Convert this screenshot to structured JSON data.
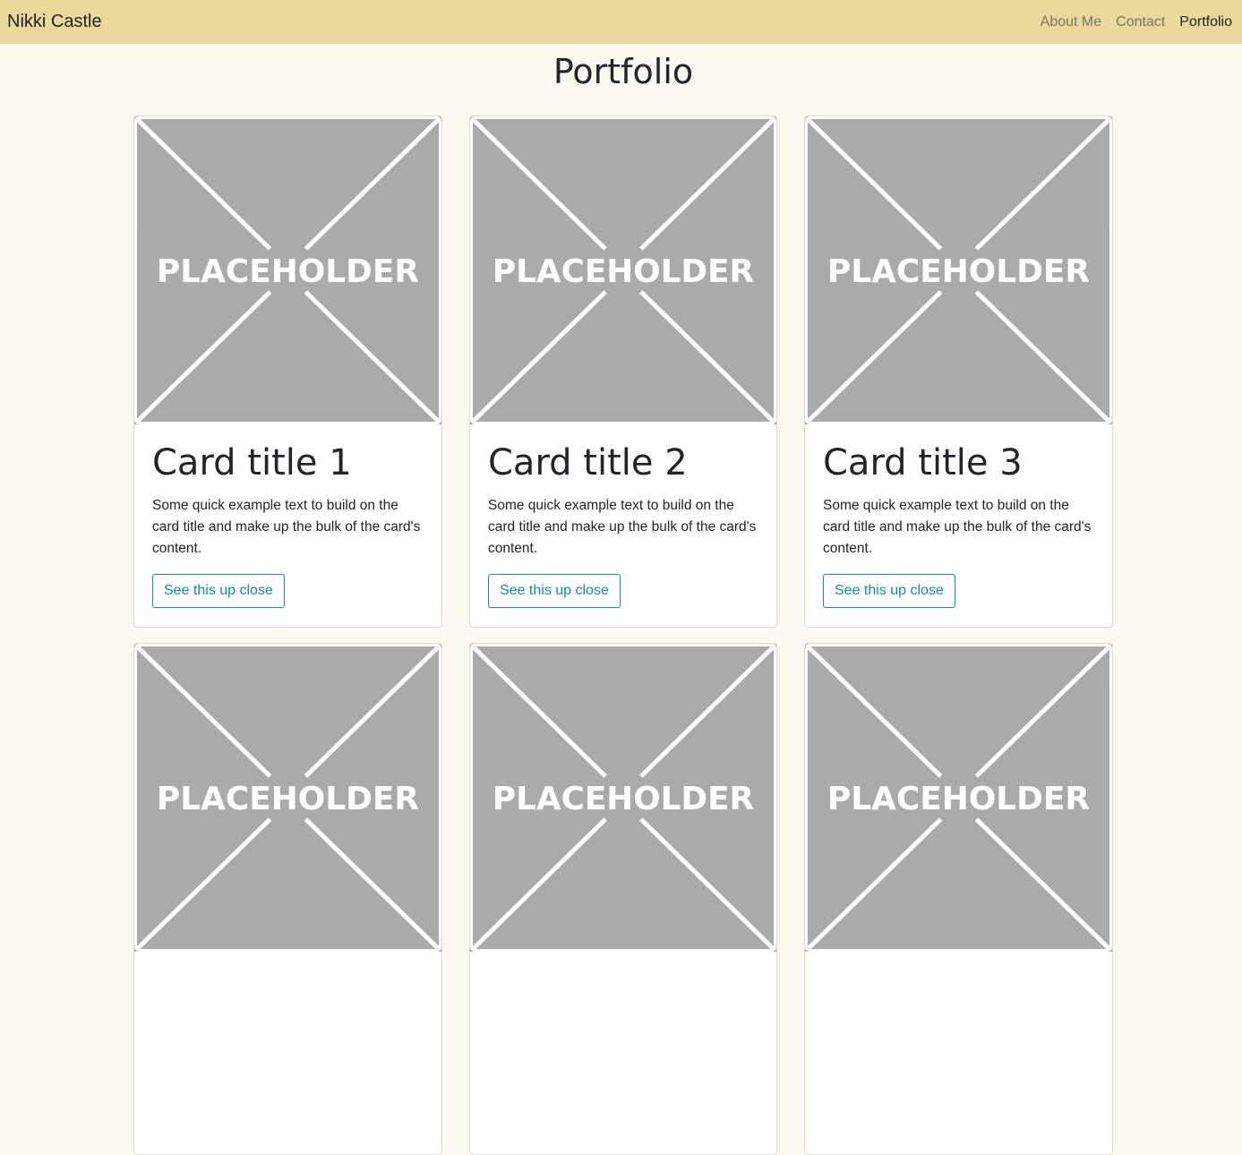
{
  "nav": {
    "brand": "Nikki Castle",
    "links": [
      {
        "label": "About Me",
        "active": false
      },
      {
        "label": "Contact",
        "active": false
      },
      {
        "label": "Portfolio",
        "active": true
      }
    ]
  },
  "page": {
    "title": "Portfolio"
  },
  "placeholder_text": "PLACEHOLDER",
  "cards": [
    {
      "title": "Card title 1",
      "text": "Some quick example text to build on the card title and make up the bulk of the card's content.",
      "button": "See this up close"
    },
    {
      "title": "Card title 2",
      "text": "Some quick example text to build on the card title and make up the bulk of the card's content.",
      "button": "See this up close"
    },
    {
      "title": "Card title 3",
      "text": "Some quick example text to build on the card title and make up the bulk of the card's content.",
      "button": "See this up close"
    },
    {
      "title": "",
      "text": "",
      "button": ""
    },
    {
      "title": "",
      "text": "",
      "button": ""
    },
    {
      "title": "",
      "text": "",
      "button": ""
    }
  ],
  "colors": {
    "navbar_bg": "#ead89c",
    "page_bg": "#fcf9f1",
    "button_accent": "#138f9f",
    "placeholder_bg": "#aaaaaa"
  }
}
